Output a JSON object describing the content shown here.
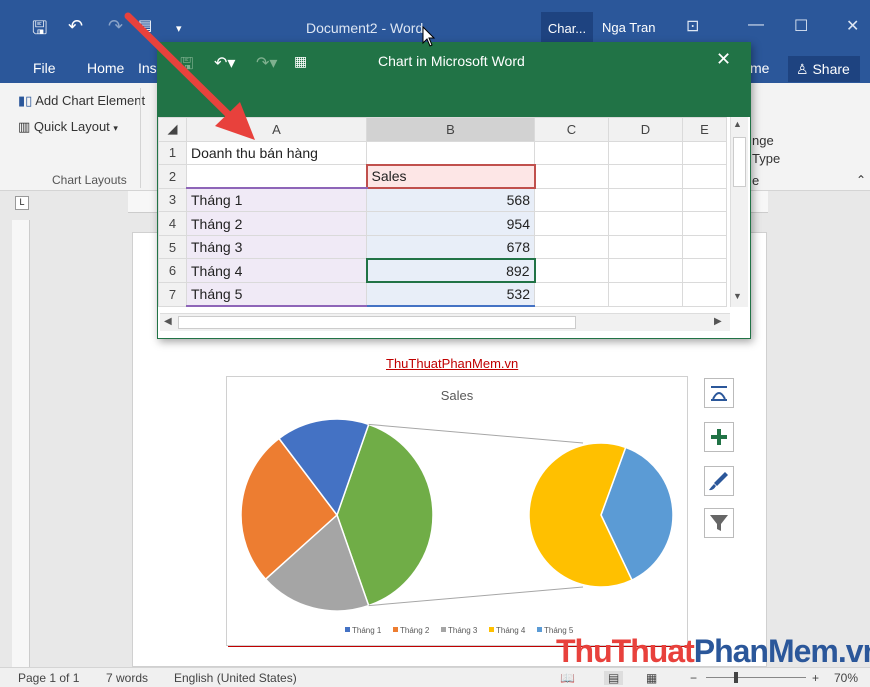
{
  "word": {
    "doc_title": "Document2 - Word",
    "context_tab": "Char...",
    "user": "Nga Tran",
    "tabs": [
      "File",
      "Home",
      "Ins"
    ],
    "share": "Share",
    "ribbon_buttons": [
      "Add Chart Element",
      "Quick Layout"
    ],
    "group_label": "Chart Layouts",
    "ribbon_right_partial": [
      "nge",
      "Type",
      "e"
    ],
    "tab_partial": "me"
  },
  "excel": {
    "title": "Chart in Microsoft Word",
    "columns": [
      "A",
      "B",
      "C",
      "D",
      "E"
    ],
    "row_numbers": [
      "1",
      "2",
      "3",
      "4",
      "5",
      "6",
      "7"
    ],
    "a1": "Doanh thu bán hàng",
    "b2": "Sales",
    "rows": [
      {
        "label": "Tháng 1",
        "value": "568"
      },
      {
        "label": "Tháng 2",
        "value": "954"
      },
      {
        "label": "Tháng 3",
        "value": "678"
      },
      {
        "label": "Tháng 4",
        "value": "892"
      },
      {
        "label": "Tháng 5",
        "value": "532"
      }
    ]
  },
  "watermark_top": "ThuThuatPhanMem.vn",
  "brand": {
    "part1": "Thu",
    "part2": "Thuat",
    "part3": "PhanMem",
    "part4": ".vn"
  },
  "chart_data": {
    "type": "pie",
    "subtype": "pie-of-pie",
    "title": "Sales",
    "categories": [
      "Tháng 1",
      "Tháng 2",
      "Tháng 3",
      "Tháng 4",
      "Tháng 5"
    ],
    "values": [
      568,
      954,
      678,
      892,
      532
    ],
    "colors": [
      "#4472c4",
      "#ed7d31",
      "#a5a5a5",
      "#ffc000",
      "#5b9bd5"
    ],
    "other_color": "#70ad47",
    "secondary_categories": [
      "Tháng 4",
      "Tháng 5"
    ],
    "legend_position": "bottom"
  },
  "status": {
    "page": "Page 1 of 1",
    "words": "7 words",
    "language": "English (United States)",
    "zoom": "70%"
  },
  "colors": {
    "word_blue": "#2b579a",
    "excel_green": "#217346",
    "arrow": "#e8413c",
    "brand_red": "#e8413c",
    "brand_blue": "#2b579a"
  }
}
